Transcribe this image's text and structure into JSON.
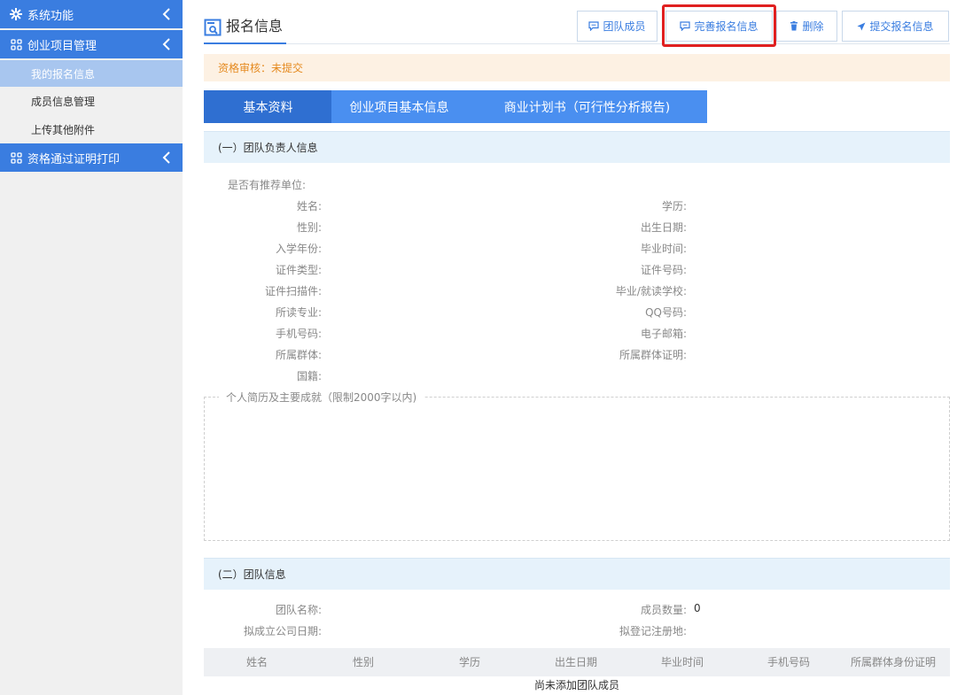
{
  "sidebar": {
    "groups": [
      {
        "label": "系统功能",
        "icon": "gear-icon"
      },
      {
        "label": "创业项目管理",
        "icon": "grid-icon"
      },
      {
        "label": "资格通过证明打印",
        "icon": "grid-icon"
      }
    ],
    "items": [
      {
        "label": "我的报名信息",
        "active": true
      },
      {
        "label": "成员信息管理",
        "active": false
      },
      {
        "label": "上传其他附件",
        "active": false
      }
    ]
  },
  "header": {
    "title": "报名信息",
    "buttons": {
      "team_members": "团队成员",
      "complete_info": "完善报名信息",
      "delete": "删除",
      "submit": "提交报名信息"
    }
  },
  "audit": {
    "label": "资格审核：",
    "value": "未提交"
  },
  "tabs": [
    "基本资料",
    "创业项目基本信息",
    "商业计划书（可行性分析报告)"
  ],
  "leader": {
    "section_title": "(一）团队负责人信息",
    "recommend_unit": "是否有推荐单位:",
    "left_fields": [
      "姓名:",
      "性别:",
      "入学年份:",
      "证件类型:",
      "证件扫描件:",
      "所读专业:",
      "手机号码:",
      "所属群体:",
      "国籍:"
    ],
    "right_fields": [
      "学历:",
      "出生日期:",
      "毕业时间:",
      "证件号码:",
      "毕业/就读学校:",
      "QQ号码:",
      "电子邮箱:",
      "所属群体证明:"
    ],
    "resume_legend": "个人简历及主要成就（限制2000字以内)"
  },
  "team": {
    "section_title": "(二）团队信息",
    "team_name_label": "团队名称:",
    "member_count_label": "成员数量:",
    "member_count_value": "0",
    "company_date_label": "拟成立公司日期:",
    "register_place_label": "拟登记注册地:",
    "table": {
      "columns": [
        "姓名",
        "性别",
        "学历",
        "出生日期",
        "毕业时间",
        "手机号码",
        "所属群体身份证明"
      ],
      "empty_text": "尚未添加团队成员"
    }
  },
  "colors": {
    "primary": "#3a7de0",
    "tab_dark": "#2f6fd1",
    "tab_light": "#4a8ff0",
    "highlight": "#e02020",
    "audit_text": "#e58a1f",
    "audit_bg": "#fdf1e3"
  }
}
